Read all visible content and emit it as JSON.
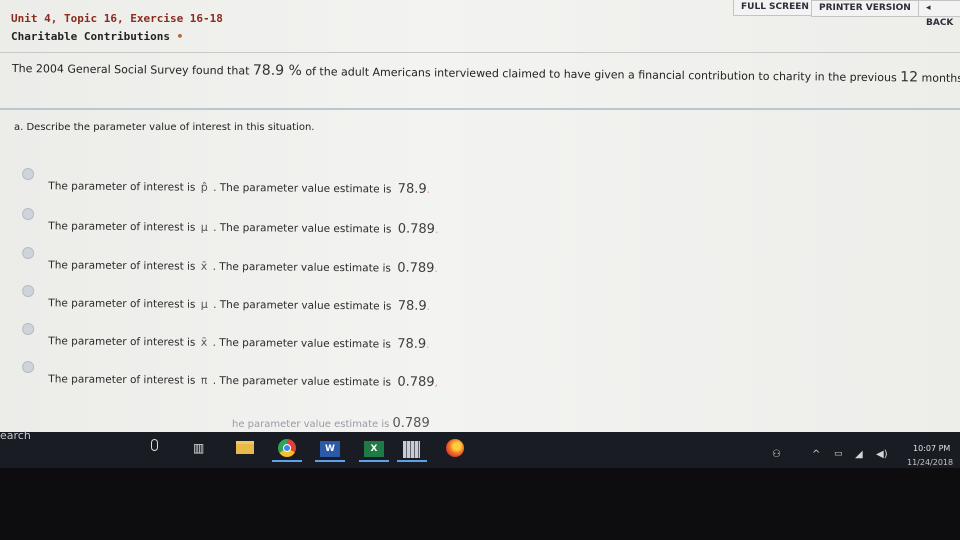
{
  "topbar": {
    "full_screen": "FULL SCREEN",
    "printer_version": "PRINTER VERSION",
    "back": "◂ BACK"
  },
  "header": {
    "title": "Unit 4, Topic 16, Exercise 16-18",
    "subtitle": "Charitable Contributions"
  },
  "problem": {
    "prefix": "The 2004 General Social Survey found that",
    "percent": "78.9 %",
    "middle": "of the adult Americans interviewed claimed to have given a financial contribution to charity in the previous",
    "months_value": "12",
    "suffix": "months."
  },
  "question": {
    "label": "a. Describe the parameter value of interest in this situation."
  },
  "options": [
    {
      "lead": "The parameter of interest is",
      "symbol": "p̂",
      "mid": ". The parameter value estimate is",
      "value": "78.9"
    },
    {
      "lead": "The parameter of interest is",
      "symbol": "μ",
      "mid": ". The parameter value estimate is",
      "value": "0.789"
    },
    {
      "lead": "The parameter of interest is",
      "symbol": "x̄",
      "mid": ". The parameter value estimate is",
      "value": "0.789"
    },
    {
      "lead": "The parameter of interest is",
      "symbol": "μ",
      "mid": ". The parameter value estimate is",
      "value": "78.9"
    },
    {
      "lead": "The parameter of interest is",
      "symbol": "x̄",
      "mid": ". The parameter value estimate is",
      "value": "78.9"
    },
    {
      "lead": "The parameter of interest is",
      "symbol": "π",
      "mid": ". The parameter value estimate is",
      "value": "0.789"
    }
  ],
  "cutoff_option": {
    "text": "he parameter value estimate is",
    "value": "0.789"
  },
  "taskbar": {
    "search_text": "earch",
    "word_letter": "W",
    "excel_letter": "X",
    "help_glyph": "?",
    "clock_time": "10:07 PM",
    "clock_date": "11/24/2018"
  },
  "icons": {
    "help": "help-icon",
    "people": "people-icon",
    "chevron": "chevron-up-icon",
    "battery": "battery-icon",
    "network": "network-icon",
    "volume": "volume-icon"
  },
  "colors": {
    "title": "#8a2b1c",
    "taskbar": "#1a1c24",
    "radio": "#cfd4da"
  }
}
